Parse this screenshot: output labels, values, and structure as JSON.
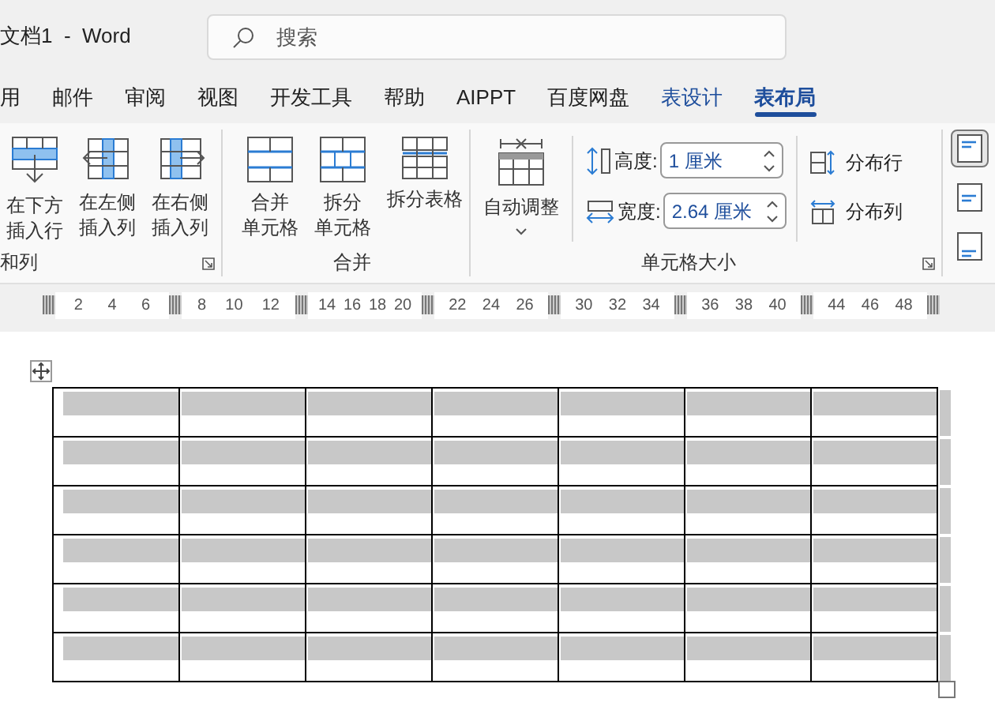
{
  "window": {
    "title": "文档1  -  Word"
  },
  "search": {
    "placeholder": "搜索"
  },
  "tabs": [
    {
      "label": "用",
      "selected": false
    },
    {
      "label": "邮件",
      "selected": false
    },
    {
      "label": "审阅",
      "selected": false
    },
    {
      "label": "视图",
      "selected": false
    },
    {
      "label": "开发工具",
      "selected": false
    },
    {
      "label": "帮助",
      "selected": false
    },
    {
      "label": "AIPPT",
      "selected": false
    },
    {
      "label": "百度网盘",
      "selected": false
    },
    {
      "label": "表设计",
      "selected": false,
      "contextual": true
    },
    {
      "label": "表布局",
      "selected": true,
      "contextual": true
    }
  ],
  "ribbon": {
    "groups": [
      {
        "label": "和列",
        "buttons": [
          {
            "kind": "insert-below",
            "lines": [
              "在下方",
              "插入行"
            ]
          },
          {
            "kind": "insert-left",
            "lines": [
              "在左侧",
              "插入列"
            ]
          },
          {
            "kind": "insert-right",
            "lines": [
              "在右侧",
              "插入列"
            ]
          }
        ]
      },
      {
        "label": "合并",
        "buttons": [
          {
            "kind": "merge",
            "lines": [
              "合并",
              "单元格"
            ]
          },
          {
            "kind": "split",
            "lines": [
              "拆分",
              "单元格"
            ]
          },
          {
            "kind": "split-table",
            "lines": [
              "拆分表格"
            ]
          }
        ]
      }
    ],
    "cell_size": {
      "label": "单元格大小",
      "autofit": "自动调整",
      "height_label": "高度:",
      "height": "1 厘米",
      "width_label": "宽度:",
      "width": "2.64 厘米",
      "distribute_rows": "分布行",
      "distribute_columns": "分布列"
    },
    "alignment": [
      {
        "kind": "top",
        "selected": true
      },
      {
        "kind": "middle",
        "selected": false
      },
      {
        "kind": "bottom",
        "selected": false
      }
    ]
  },
  "ruler": [
    [
      "2",
      "4",
      "6"
    ],
    [
      "8",
      "10",
      "12"
    ],
    [
      "14",
      "16",
      "18",
      "20"
    ],
    [
      "22",
      "24",
      "26"
    ],
    [
      "30",
      "32",
      "34"
    ],
    [
      "36",
      "38",
      "40"
    ],
    [
      "44",
      "46",
      "48"
    ]
  ],
  "table": {
    "rows": [
      {
        "cells": [
          {
            "selected": true
          },
          {
            "selected": true
          },
          {
            "selected": true
          },
          {
            "selected": true
          },
          {
            "selected": true
          },
          {
            "selected": true
          },
          {
            "selected": true
          }
        ]
      },
      {
        "cells": [
          {
            "selected": true
          },
          {
            "selected": true
          },
          {
            "selected": true
          },
          {
            "selected": true
          },
          {
            "selected": true
          },
          {
            "selected": true
          },
          {
            "selected": true
          }
        ]
      },
      {
        "cells": [
          {
            "selected": true
          },
          {
            "selected": true
          },
          {
            "selected": true
          },
          {
            "selected": true
          },
          {
            "selected": true
          },
          {
            "selected": true
          },
          {
            "selected": true
          }
        ]
      },
      {
        "cells": [
          {
            "selected": true
          },
          {
            "selected": true
          },
          {
            "selected": true
          },
          {
            "selected": true
          },
          {
            "selected": true
          },
          {
            "selected": true
          },
          {
            "selected": true
          }
        ]
      },
      {
        "cells": [
          {
            "selected": true
          },
          {
            "selected": true
          },
          {
            "selected": true
          },
          {
            "selected": true
          },
          {
            "selected": true
          },
          {
            "selected": true
          },
          {
            "selected": true
          }
        ]
      },
      {
        "cells": [
          {
            "selected": true
          },
          {
            "selected": true
          },
          {
            "selected": true
          },
          {
            "selected": true
          },
          {
            "selected": true
          },
          {
            "selected": true
          },
          {
            "selected": true
          }
        ]
      }
    ]
  }
}
